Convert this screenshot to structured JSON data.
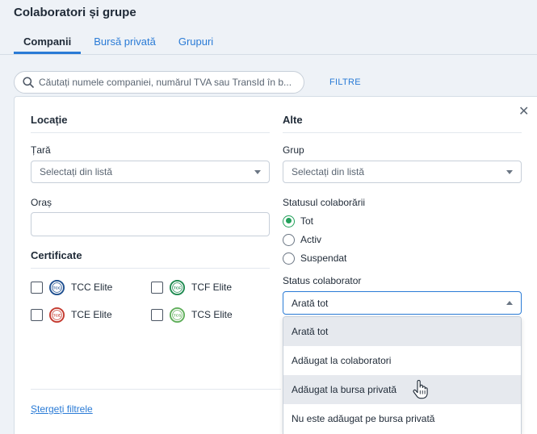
{
  "page": {
    "title": "Colaboratori și grupe"
  },
  "tabs": [
    {
      "label": "Companii",
      "active": true
    },
    {
      "label": "Bursă privată",
      "active": false
    },
    {
      "label": "Grupuri",
      "active": false
    }
  ],
  "search": {
    "placeholder": "Căutați numele companiei, numărul TVA sau TransId în b...",
    "value": ""
  },
  "filters_button": "FILTRE",
  "left": {
    "location_title": "Locație",
    "country": {
      "label": "Țară",
      "placeholder": "Selectați din listă"
    },
    "city": {
      "label": "Oraș",
      "value": ""
    },
    "certificates_title": "Certificate",
    "certificates": [
      {
        "label": "TCC Elite",
        "badge": "TCC",
        "color": "#1d4e8f",
        "checked": false
      },
      {
        "label": "TCF Elite",
        "badge": "TCF",
        "color": "#1e8a50",
        "checked": false
      },
      {
        "label": "TCE Elite",
        "badge": "TCE",
        "color": "#c4392e",
        "checked": false
      },
      {
        "label": "TCS Elite",
        "badge": "TCS",
        "color": "#5fae5a",
        "checked": false
      }
    ],
    "clear_filters": "Ștergeți filtrele"
  },
  "right": {
    "other_title": "Alte",
    "group": {
      "label": "Grup",
      "placeholder": "Selectați din listă"
    },
    "collab_status": {
      "label": "Statusul colaborării",
      "options": [
        {
          "label": "Tot",
          "checked": true
        },
        {
          "label": "Activ",
          "checked": false
        },
        {
          "label": "Suspendat",
          "checked": false
        }
      ]
    },
    "collaborator_status": {
      "label": "Status colaborator",
      "value": "Arată tot",
      "options": [
        {
          "label": "Arată tot",
          "selected": true
        },
        {
          "label": "Adăugat la colaboratori",
          "selected": false
        },
        {
          "label": "Adăugat la bursa privată",
          "selected": false,
          "hovered": true
        },
        {
          "label": "Nu este adăugat pe bursa privată",
          "selected": false
        }
      ]
    }
  },
  "colors": {
    "accent": "#2a7bd6",
    "radio_checked": "#22a05a"
  },
  "icons": {
    "close": "close-icon",
    "search": "search-icon",
    "cursor": "hand-pointer-icon"
  }
}
